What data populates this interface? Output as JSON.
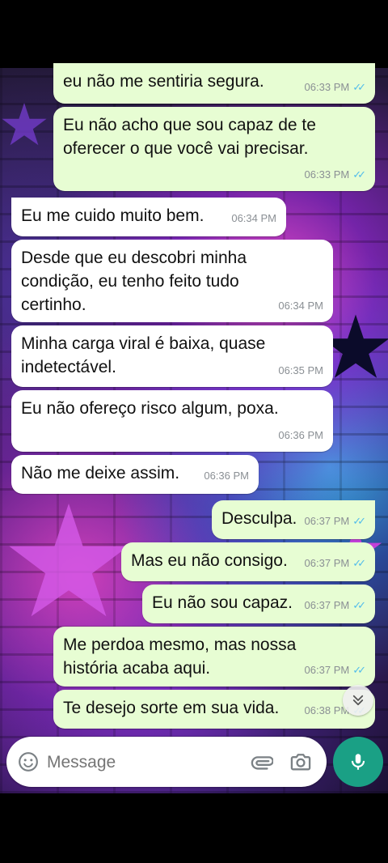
{
  "messages": [
    {
      "dir": "out",
      "lines": [
        "eu não me sentiria segura."
      ],
      "time": "06:33 PM"
    },
    {
      "dir": "out",
      "lines": [
        "Eu não acho que sou capaz de te",
        "oferecer o que você vai precisar."
      ],
      "time": "06:33 PM"
    },
    {
      "dir": "in",
      "lines": [
        "Eu me cuido muito bem."
      ],
      "time": "06:34 PM"
    },
    {
      "dir": "in",
      "lines": [
        "Desde que eu descobri minha",
        "condição, eu tenho feito tudo",
        "certinho."
      ],
      "time": "06:34 PM"
    },
    {
      "dir": "in",
      "lines": [
        "Minha carga viral é baixa, quase",
        "indetectável."
      ],
      "time": "06:35 PM"
    },
    {
      "dir": "in",
      "lines": [
        "Eu não ofereço risco algum, poxa."
      ],
      "time": "06:36 PM"
    },
    {
      "dir": "in",
      "lines": [
        "Não me deixe assim."
      ],
      "time": "06:36 PM"
    },
    {
      "dir": "out",
      "lines": [
        "Desculpa."
      ],
      "time": "06:37 PM"
    },
    {
      "dir": "out",
      "lines": [
        "Mas eu não consigo."
      ],
      "time": "06:37 PM"
    },
    {
      "dir": "out",
      "lines": [
        "Eu não sou capaz."
      ],
      "time": "06:37 PM"
    },
    {
      "dir": "out",
      "lines": [
        "Me perdoa mesmo, mas nossa",
        "história acaba aqui."
      ],
      "time": "06:37 PM"
    },
    {
      "dir": "out",
      "lines": [
        "Te desejo sorte em sua vida."
      ],
      "time": "06:38 PM"
    }
  ],
  "composer": {
    "placeholder": "Message"
  },
  "icons": {
    "emoji": "emoji-icon",
    "attach": "paperclip-icon",
    "camera": "camera-icon",
    "mic": "microphone-icon",
    "scroll": "double-chevron-down-icon",
    "read_receipt": "double-check-icon"
  },
  "colors": {
    "incoming": "#ffffff",
    "outgoing": "#e7fdd3",
    "read_receipt": "#53bdeb",
    "mic_button": "#1aa085"
  }
}
